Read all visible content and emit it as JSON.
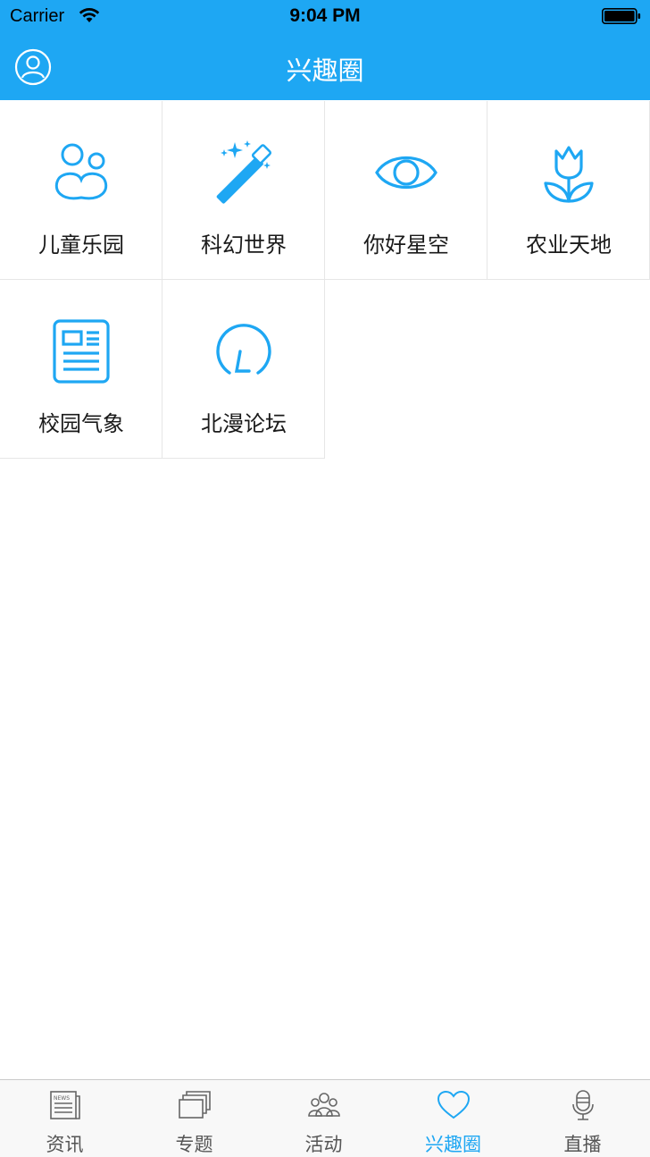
{
  "status_bar": {
    "carrier": "Carrier",
    "time": "9:04 PM"
  },
  "navbar": {
    "title": "兴趣圈",
    "profile_icon": "user-profile-icon"
  },
  "grid": [
    {
      "label": "儿童乐园",
      "icon": "children-icon"
    },
    {
      "label": "科幻世界",
      "icon": "magic-wand-icon"
    },
    {
      "label": "你好星空",
      "icon": "eye-icon"
    },
    {
      "label": "农业天地",
      "icon": "tulip-icon"
    },
    {
      "label": "校园气象",
      "icon": "newspaper-icon"
    },
    {
      "label": "北漫论坛",
      "icon": "forum-icon"
    }
  ],
  "tabs": [
    {
      "label": "资讯",
      "icon": "news-icon",
      "active": false
    },
    {
      "label": "专题",
      "icon": "layers-icon",
      "active": false
    },
    {
      "label": "活动",
      "icon": "group-icon",
      "active": false
    },
    {
      "label": "兴趣圈",
      "icon": "heart-icon",
      "active": true
    },
    {
      "label": "直播",
      "icon": "microphone-icon",
      "active": false
    }
  ],
  "colors": {
    "accent": "#1ea7f3",
    "tab_inactive": "#555555",
    "divider": "#e6e6e6"
  }
}
